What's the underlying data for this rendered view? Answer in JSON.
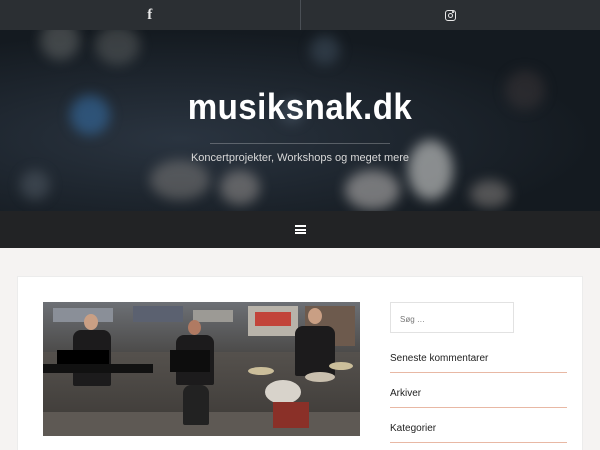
{
  "social": {
    "facebook_icon": "facebook-icon",
    "instagram_icon": "instagram-icon"
  },
  "hero": {
    "title": "musiksnak.dk",
    "tagline": "Koncertprojekter, Workshops og meget mere"
  },
  "nav": {
    "menu_icon": "hamburger-menu-icon"
  },
  "sidebar": {
    "search_placeholder": "Søg …",
    "widgets": [
      {
        "title": "Seneste kommentarer"
      },
      {
        "title": "Arkiver"
      },
      {
        "title": "Kategorier"
      }
    ]
  },
  "colors": {
    "social_bar": "#2b2f33",
    "nav_bar": "#222325",
    "widget_rule": "#e8b8a4"
  }
}
